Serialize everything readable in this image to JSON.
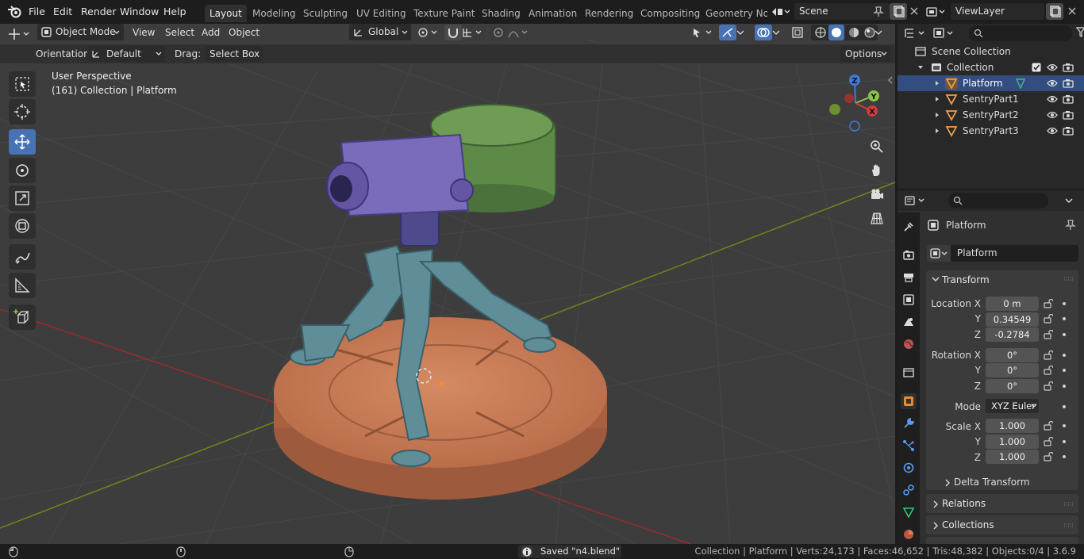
{
  "menu": {
    "file": "File",
    "edit": "Edit",
    "render": "Render",
    "window": "Window",
    "help": "Help"
  },
  "workspaces": [
    "Layout",
    "Modeling",
    "Sculpting",
    "UV Editing",
    "Texture Paint",
    "Shading",
    "Animation",
    "Rendering",
    "Compositing",
    "Geometry Noc"
  ],
  "scene": {
    "name": "Scene"
  },
  "view_layer": {
    "name": "ViewLayer"
  },
  "viewport_header": {
    "mode": "Object Mode",
    "view": "View",
    "select": "Select",
    "add": "Add",
    "object": "Object",
    "transform_orientation": "Global"
  },
  "tool_header": {
    "orientation_label": "Orientation:",
    "orientation_value": "Default",
    "drag_label": "Drag:",
    "drag_value": "Select Box",
    "options": "Options"
  },
  "viewport_info": {
    "perspective": "User Perspective",
    "context": "(161) Collection | Platform"
  },
  "gizmo": {
    "z": "Z",
    "y": "Y",
    "x": "X"
  },
  "outliner": {
    "scene_collection": "Scene Collection",
    "collection": "Collection",
    "objects": [
      "Platform",
      "SentryPart1",
      "SentryPart2",
      "SentryPart3"
    ]
  },
  "properties": {
    "object_name": "Platform",
    "data_name": "Platform",
    "transform": {
      "title": "Transform",
      "location_label": "Location X",
      "y_label": "Y",
      "z_label": "Z",
      "location": [
        "0 m",
        "0.34549",
        "-0.2784"
      ],
      "rotation_label": "Rotation X",
      "rotation": [
        "0°",
        "0°",
        "0°"
      ],
      "mode_label": "Mode",
      "mode_value": "XYZ Euler",
      "scale_label": "Scale X",
      "scale": [
        "1.000",
        "1.000",
        "1.000"
      ]
    },
    "delta_transform": "Delta Transform",
    "relations": "Relations",
    "collections": "Collections"
  },
  "status": {
    "message": "Saved \"n4.blend\"",
    "stats": "Collection | Platform | Verts:24,173 | Faces:46,652 | Tris:48,382 | Objects:0/4 | 3.6.9"
  },
  "colors": {
    "accent": "#4772b3",
    "viewport_bg": "#3d3d3d",
    "axis_red": "#c0392b",
    "axis_green": "#8bc34a",
    "object_orange": "#e89a57"
  }
}
